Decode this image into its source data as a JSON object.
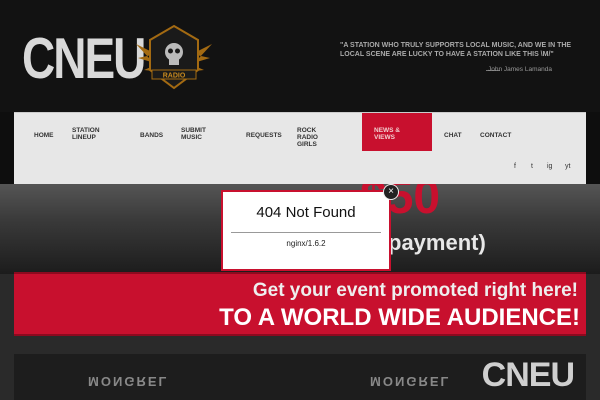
{
  "header": {
    "logo": "CNEU",
    "badge_text": "RADIO",
    "quote": "\"A STATION WHO TRULY SUPPORTS LOCAL MUSIC, AND WE IN THE LOCAL SCENE ARE LUCKY TO HAVE A STATION LIKE THIS \\M/\"",
    "quote_author": "John James Lamanda"
  },
  "nav": {
    "items": [
      {
        "label": "HOME"
      },
      {
        "label": "STATION LINEUP"
      },
      {
        "label": "BANDS"
      },
      {
        "label": "SUBMIT MUSIC"
      },
      {
        "label": "REQUESTS"
      },
      {
        "label": "ROCK RADIO GIRLS"
      },
      {
        "label": "NEWS & VIEWS"
      },
      {
        "label": "CHAT"
      },
      {
        "label": "CONTACT"
      }
    ],
    "social": [
      "f",
      "t",
      "ig",
      "yt"
    ]
  },
  "hero": {
    "top_text": "$50",
    "payment_text": "payment)",
    "banner_line1": "Get your event promoted right here!",
    "banner_line2": "TO A WORLD WIDE AUDIENCE!",
    "mongrel_left": "MONGREL",
    "mongrel_right": "MONGREL",
    "logo_small": "CNEU"
  },
  "modal": {
    "title": "404 Not Found",
    "subtitle": "nginx/1.6.2",
    "close_label": "×"
  },
  "colors": {
    "accent": "#c8102e",
    "nav_bg": "#e7e7e7",
    "dark_bg": "#0e0e0e"
  }
}
